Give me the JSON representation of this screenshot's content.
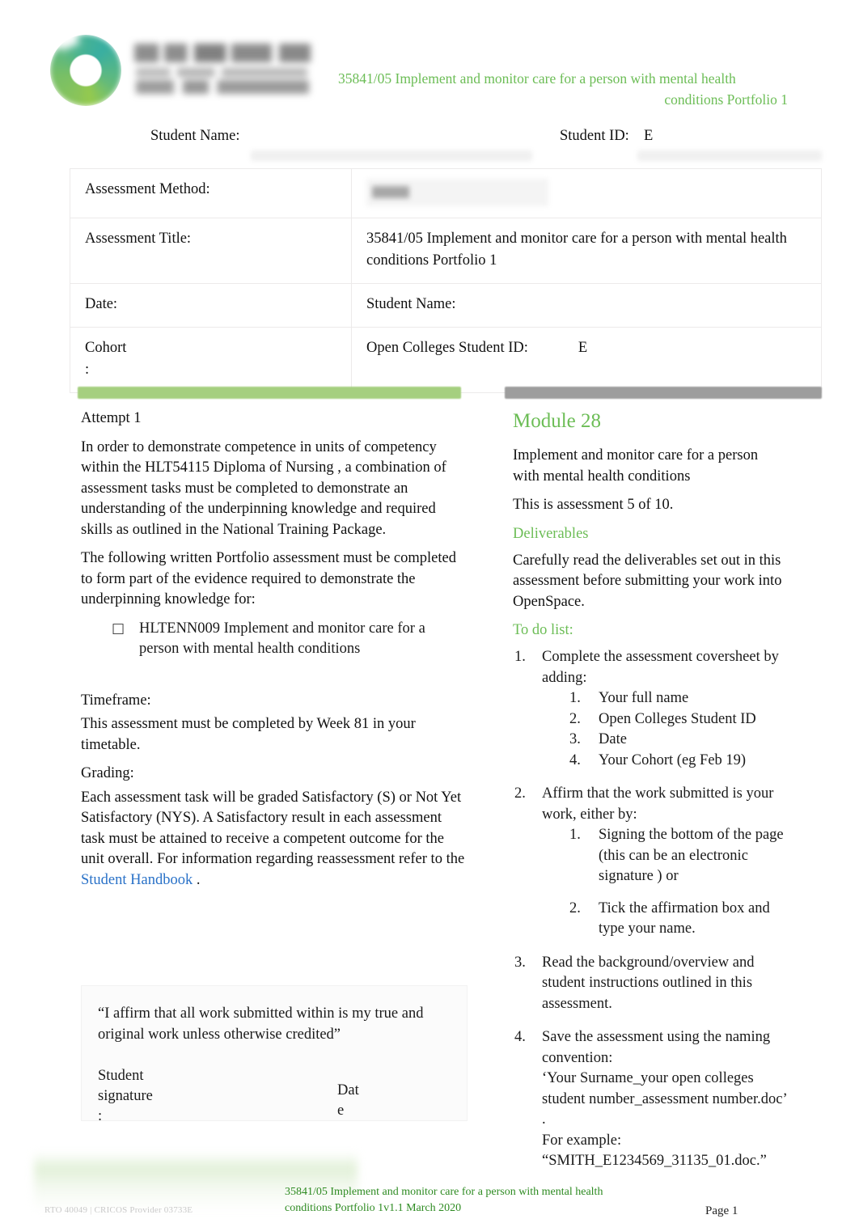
{
  "header": {
    "logo_alt": "Open Colleges School of Health",
    "title_line_1": "35841/05 Implement and monitor care for a person with mental health",
    "title_line_2": "conditions Portfolio 1",
    "accent_green": "#6cbd56"
  },
  "student_row": {
    "name_label": "Student Name:",
    "id_label": "Student ID:",
    "id_value": "E"
  },
  "coversheet": {
    "method_label": "Assessment Method:",
    "method_value": "",
    "title_label": "Assessment Title:",
    "title_value_line_1": "35841/05 Implement and monitor care for a person with mental health",
    "title_value_line_2": "conditions Portfolio 1",
    "date_label": "Date:",
    "name_label": "Student Name:",
    "cohort_label": "Cohort",
    "cohort_colon": ":",
    "oc_id_label": "Open Colleges Student ID:",
    "oc_id_value": "E"
  },
  "left_column": {
    "attempt": "Attempt 1",
    "para_1": "In order to demonstrate competence in units of competency within the    HLT54115 Diploma of Nursing  , a combination of assessment tasks must be completed to demonstrate an understanding of the underpinning knowledge and required skills as outlined in the National Training Package.",
    "para_2": "The following written Portfolio assessment must be completed to form part of the evidence required to demonstrate the underpinning knowledge for:",
    "bullet_glyph": "□",
    "bullet_text": "HLTENN009  Implement and monitor care for a person with mental health conditions",
    "timeframe_heading": "Timeframe:",
    "timeframe_text": "This assessment must be completed by        Week 81   in your timetable.",
    "grading_heading": "Grading:",
    "grading_text_before_link": "Each assessment task will be graded Satisfactory (S) or Not Yet Satisfactory (NYS).      A Satisfactory result in each assessment task must be attained to receive a competent outcome for the unit overall. For information regarding reassessment refer to the ",
    "grading_link": "Student Handbook",
    "grading_text_after_link": "   .",
    "affirm_quote": "“I affirm that all work submitted within is my true and original work unless otherwise credited”",
    "signature_label_line_1": "Student",
    "signature_label_line_2": "signature",
    "signature_label_line_3": ":",
    "date_label_line_1": "Dat",
    "date_label_line_2": "e"
  },
  "right_column": {
    "module_heading": "Module 28",
    "module_subtitle": "Implement and monitor care for a person with mental health conditions",
    "assessment_count": "This is assessment 5 of 10.",
    "deliverables_heading": "Deliverables",
    "deliverables_text": "Carefully read the deliverables set out in this assessment before submitting your work into OpenSpace.",
    "todo_heading": "To do list:",
    "todo": [
      {
        "num": "1.",
        "text": "Complete the assessment coversheet by adding:",
        "sub": [
          {
            "num": "1.",
            "text": "Your full name"
          },
          {
            "num": "2.",
            "text": "Open Colleges Student ID"
          },
          {
            "num": "3.",
            "text": "Date"
          },
          {
            "num": "4.",
            "text": "Your Cohort (eg Feb 19)"
          }
        ]
      },
      {
        "num": "2.",
        "text": "Affirm that the work submitted is your work, either by:",
        "sub": [
          {
            "num": "1.",
            "text": "Signing the bottom of the page (this can be an electronic signature   ) or"
          },
          {
            "num": "2.",
            "text": "Tick the affirmation box and type your name."
          }
        ]
      },
      {
        "num": "3.",
        "text": "Read the background/overview and student instructions outlined in this assessment.",
        "sub": []
      },
      {
        "num": "4.",
        "text": "Save the assessment using the naming convention:",
        "extra_lines": [
          "‘Your Surname_your open colleges student number_assessment number.doc’  .",
          "For example:",
          "“SMITH_E1234569_31135_01.doc.”"
        ],
        "sub": []
      }
    ]
  },
  "footer": {
    "rto": "RTO 40049   |  CRICOS Provider 03733E",
    "center_line_1": "35841/05 Implement and monitor care for a person with mental health",
    "center_line_2": "conditions Portfolio 1v1.1 March 2020",
    "page": "Page 1"
  }
}
